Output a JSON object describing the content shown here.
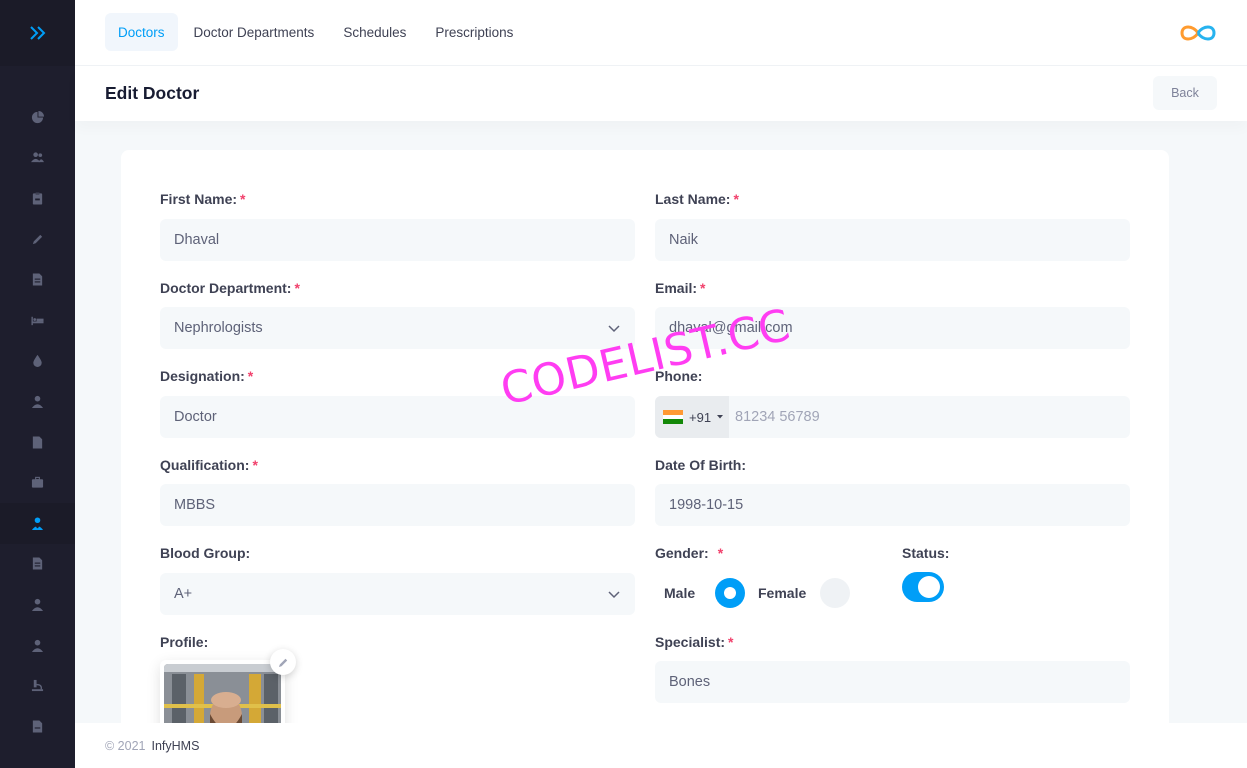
{
  "nav": {
    "tabs": [
      {
        "label": "Doctors",
        "active": true
      },
      {
        "label": "Doctor Departments",
        "active": false
      },
      {
        "label": "Schedules",
        "active": false
      },
      {
        "label": "Prescriptions",
        "active": false
      }
    ]
  },
  "sidebar": {
    "icons": [
      "dashboard-icon",
      "users-icon",
      "clipboard-icon",
      "pen-icon",
      "file-icon",
      "bed-icon",
      "blood-drop-icon",
      "user-tie-icon",
      "document-icon",
      "briefcase-icon",
      "doctor-icon",
      "invoice-icon",
      "user-nurse-icon",
      "user-icon",
      "lab-icon",
      "report-icon"
    ],
    "active_index": 10
  },
  "header": {
    "title": "Edit Doctor",
    "back_label": "Back"
  },
  "form": {
    "first_name": {
      "label": "First Name:",
      "value": "Dhaval"
    },
    "last_name": {
      "label": "Last Name:",
      "value": "Naik"
    },
    "department": {
      "label": "Doctor Department:",
      "value": "Nephrologists"
    },
    "email": {
      "label": "Email:",
      "value": "dhaval@gmail.com"
    },
    "designation": {
      "label": "Designation:",
      "value": "Doctor"
    },
    "phone": {
      "label": "Phone:",
      "country_code": "+91",
      "placeholder": "81234 56789"
    },
    "qualification": {
      "label": "Qualification:",
      "value": "MBBS"
    },
    "dob": {
      "label": "Date Of Birth:",
      "value": "1998-10-15"
    },
    "blood_group": {
      "label": "Blood Group:",
      "value": "A+"
    },
    "gender": {
      "label": "Gender:",
      "options": [
        "Male",
        "Female"
      ],
      "selected": "Male"
    },
    "status": {
      "label": "Status:",
      "enabled": true
    },
    "profile": {
      "label": "Profile:"
    },
    "specialist": {
      "label": "Specialist:",
      "value": "Bones"
    },
    "required_mark": "*"
  },
  "footer": {
    "copyright": "© 2021",
    "brand": "InfyHMS"
  },
  "watermark": "CODELIST.CC",
  "colors": {
    "accent": "#009ef7",
    "sidebar": "#1e1e2d",
    "required": "#f1416c",
    "watermark": "#ff3df2"
  }
}
